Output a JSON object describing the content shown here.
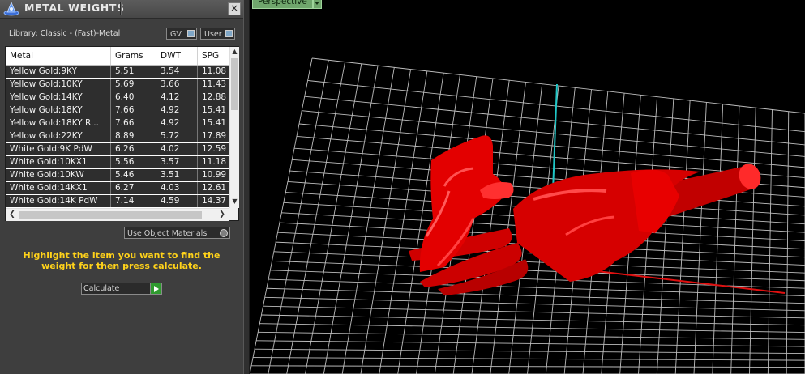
{
  "panel": {
    "title": "METAL WEIGHTS",
    "close_glyph": "×",
    "library_label": "Library: Classic - (Fast)-Metal",
    "gv_label": "GV",
    "user_label": "User",
    "table": {
      "headers": [
        "Metal",
        "Grams",
        "DWT",
        "SPG"
      ],
      "rows": [
        [
          "Yellow Gold:9KY",
          "5.51",
          "3.54",
          "11.08"
        ],
        [
          "Yellow Gold:10KY",
          "5.69",
          "3.66",
          "11.43"
        ],
        [
          "Yellow Gold:14KY",
          "6.40",
          "4.12",
          "12.88"
        ],
        [
          "Yellow Gold:18KY",
          "7.66",
          "4.92",
          "15.41"
        ],
        [
          "Yellow Gold:18KY R...",
          "7.66",
          "4.92",
          "15.41"
        ],
        [
          "Yellow Gold:22KY",
          "8.89",
          "5.72",
          "17.89"
        ],
        [
          "White Gold:9K PdW",
          "6.26",
          "4.02",
          "12.59"
        ],
        [
          "White Gold:10KX1",
          "5.56",
          "3.57",
          "11.18"
        ],
        [
          "White Gold:10KW",
          "5.46",
          "3.51",
          "10.99"
        ],
        [
          "White Gold:14KX1",
          "6.27",
          "4.03",
          "12.61"
        ],
        [
          "White Gold:14K PdW",
          "7.14",
          "4.59",
          "14.37"
        ]
      ]
    },
    "use_object_materials_label": "Use Object Materials",
    "instruction": "Highlight the item you want to find the weight for then press calculate.",
    "calculate_label": "Calculate"
  },
  "viewport": {
    "view_name": "Perspective",
    "colors": {
      "background": "#000000",
      "grid": "#bdbdbd",
      "model": "#e00000",
      "x_axis": "#e01010",
      "y_axis": "#1fc6c6"
    }
  }
}
